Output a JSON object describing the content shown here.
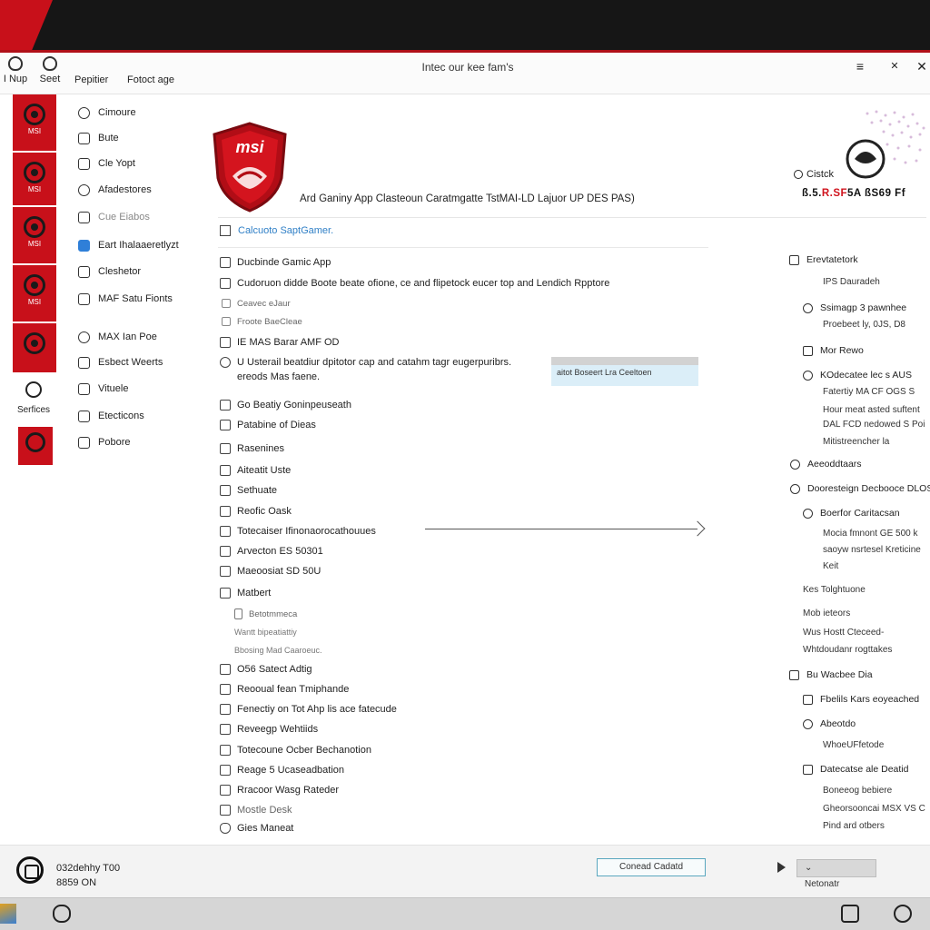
{
  "window": {
    "title": "Intec our kee fam's",
    "toolbar": [
      {
        "label": "I Nup",
        "icon": "shield-icon"
      },
      {
        "label": "Seet",
        "icon": "shield-icon"
      },
      {
        "label": "Pepitier",
        "icon": "none"
      },
      {
        "label": "Fotoct age",
        "icon": "none"
      }
    ],
    "controls": {
      "menu": "≡",
      "pin": "✕",
      "close": "✕"
    }
  },
  "rail": {
    "tiles": [
      "MSI",
      "MSI",
      "MSI",
      "MSI",
      ""
    ],
    "services_label": "Serfices"
  },
  "nav": [
    "Cimoure",
    "Bute",
    "Cle Yopt",
    "Afadestores",
    "Cue Eiabos",
    "Eart Ihalaaeretlyzt",
    "Cleshetor",
    "MAF Satu Fionts",
    "MAX Ian Poe",
    "Esbect Weerts",
    "Vituele",
    "Etecticons",
    "Pobore"
  ],
  "main": {
    "brand": "msi",
    "heading": "Ard Ganiny App Clasteoun Caratmgatte TstMAI-LD Lajuor UP DES PAS)",
    "connect_label": "Calcuoto SaptGamer.",
    "rows": [
      {
        "label": "Ducbinde Gamic App",
        "kind": "row"
      },
      {
        "label": "Cudoruon didde Boote beate ofione, ce and flipetock eucer top and Lendich Rpptore",
        "kind": "row"
      },
      {
        "label": "Ceavec eJaur",
        "kind": "sub"
      },
      {
        "label": "Froote BaeCleae",
        "kind": "sub"
      },
      {
        "label": "IE MAS Barar AMF OD",
        "kind": "row"
      },
      {
        "label": "U Usterail beatdiur dpitotor cap and catahm tagr eugerpuribrs.",
        "kind": "multi",
        "line2": "ereods Mas faene."
      },
      {
        "label": "Go Beatiy Goninpeuseath",
        "kind": "row"
      },
      {
        "label": "Patabine of Dieas",
        "kind": "row"
      },
      {
        "label": "Rasenines",
        "kind": "row"
      },
      {
        "label": "Aiteatit Uste",
        "kind": "row"
      },
      {
        "label": "Sethuate",
        "kind": "row"
      },
      {
        "label": "Reofic Oask",
        "kind": "row"
      },
      {
        "label": "Totecaiser Ifinonaorocathouues",
        "kind": "row"
      },
      {
        "label": "Arvecton ES 50301",
        "kind": "row"
      },
      {
        "label": "Maeoosiat SD 50U",
        "kind": "row"
      },
      {
        "label": "Matbert",
        "kind": "row"
      },
      {
        "label": "Betotmmeca",
        "kind": "sub2"
      },
      {
        "label": "Wantt bipeatiattiy",
        "kind": "sub3"
      },
      {
        "label": "Bbosing Mad Caaroeuc.",
        "kind": "sub3"
      },
      {
        "label": "O56 Satect Adtig",
        "kind": "row"
      },
      {
        "label": "Reooual fean Tmiphande",
        "kind": "row"
      },
      {
        "label": "Fenectiy on Tot Ahp lis ace fatecude",
        "kind": "row"
      },
      {
        "label": "Reveegp Wehtiids",
        "kind": "row"
      },
      {
        "label": "Totecoune Ocber Bechanotion",
        "kind": "row"
      },
      {
        "label": "Reage 5 Ucaseadbation",
        "kind": "row"
      },
      {
        "label": "Rracoor Wasg Rateder",
        "kind": "row"
      },
      {
        "label": "Mostle Desk",
        "kind": "row"
      },
      {
        "label": "Gies Maneat",
        "kind": "row"
      }
    ],
    "highlight_label": "aitot Boseert Lra Ceeltoen"
  },
  "right": {
    "status_label": "Cistck",
    "code_prefix": "ß.5.",
    "code_red": "R.SF",
    "code_suffix": "5A ßS69 Ff",
    "items": [
      {
        "label": "Erevtatetork",
        "kind": "icon"
      },
      {
        "label": "IPS Dauradeh",
        "kind": "text"
      },
      {
        "label": "Ssimagp 3 pawnhee",
        "kind": "icon"
      },
      {
        "label": "Proebeet ly, 0JS, D8",
        "kind": "text"
      },
      {
        "label": "Mor Rewo",
        "kind": "icon"
      },
      {
        "label": "KOdecatee lec s AUS",
        "kind": "icon"
      },
      {
        "label": "Fatertiy MA CF OGS S",
        "kind": "text"
      },
      {
        "label": "Hour meat asted suftent",
        "kind": "text"
      },
      {
        "label": "DAL FCD nedowed S Poi",
        "kind": "text"
      },
      {
        "label": "Mitistreencher la",
        "kind": "text"
      },
      {
        "label": "Aeeoddtaars",
        "kind": "round"
      },
      {
        "label": "Dooresteign Decbooce DLOS",
        "kind": "round"
      },
      {
        "label": "Boerfor Caritacsan",
        "kind": "icon"
      },
      {
        "label": "Mocia fmnont GE 500 k",
        "kind": "text"
      },
      {
        "label": "saoyw nsrtesel Kreticine",
        "kind": "text"
      },
      {
        "label": "Keit",
        "kind": "text"
      },
      {
        "label": "Kes Tolghtuone",
        "kind": "text"
      },
      {
        "label": "Mob ieteors",
        "kind": "text"
      },
      {
        "label": "Wus Hostt Cteceed-",
        "kind": "text"
      },
      {
        "label": "Whtdoudanr rogttakes",
        "kind": "text"
      },
      {
        "label": "Bu Wacbee Dia",
        "kind": "icon"
      },
      {
        "label": "Fbelils Kars eoyeached",
        "kind": "icon"
      },
      {
        "label": "Abeotdo",
        "kind": "icon"
      },
      {
        "label": "WhoeUFfetode",
        "kind": "text"
      },
      {
        "label": "Datecatse ale Deatid",
        "kind": "icon"
      },
      {
        "label": "Boneeog bebiere",
        "kind": "text"
      },
      {
        "label": "Gheorsooncai MSX VS C",
        "kind": "text"
      },
      {
        "label": "Pind ard otbers",
        "kind": "text"
      }
    ]
  },
  "footer": {
    "line1": "032dehhy T00",
    "line2": "8859 ON",
    "button1": "Conead Cadatd",
    "button2": "Netonatr"
  },
  "colors": {
    "brand_red": "#c8101a",
    "top_band": "#161616",
    "link_blue": "#2f7fc6",
    "highlight": "#dbeef8"
  }
}
